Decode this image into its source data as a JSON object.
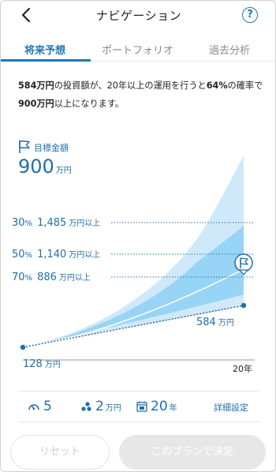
{
  "header": {
    "title": "ナビゲーション",
    "help_glyph": "?"
  },
  "tabs": [
    {
      "label": "将来予想",
      "active": true
    },
    {
      "label": "ポートフォリオ",
      "active": false
    },
    {
      "label": "過去分析",
      "active": false
    }
  ],
  "summary": {
    "amount": "584万円",
    "text1": "の投資額が、20年以上の運用を行うと",
    "probability": "64%",
    "text2": "の確率で",
    "target": "900万円",
    "text3": "以上になります。"
  },
  "target": {
    "label": "目標金額",
    "value": "900",
    "unit": "万円"
  },
  "scenarios": [
    {
      "percent": "30",
      "percent_sign": "%",
      "amount": "1,485",
      "unit": "万円以上"
    },
    {
      "percent": "50",
      "percent_sign": "%",
      "amount": "1,140",
      "unit": "万円以上"
    },
    {
      "percent": "70",
      "percent_sign": "%",
      "amount": "886",
      "unit": "万円以上"
    }
  ],
  "chart": {
    "start_value": "128",
    "start_unit": "万円",
    "end_value": "584",
    "end_unit": "万円",
    "end_year_label": "20年"
  },
  "settings": {
    "risk_value": "5",
    "monthly_value": "2",
    "monthly_unit": "万円",
    "years_value": "20",
    "years_unit": "年",
    "detail_label": "詳細設定"
  },
  "buttons": {
    "reset": "リセット",
    "decide": "このプランで決定"
  },
  "colors": {
    "accent": "#1f78b4",
    "band_outer": "#cfe9fa",
    "band_inner": "#98d4f5",
    "disabled_bg": "#e7e7e7"
  }
}
